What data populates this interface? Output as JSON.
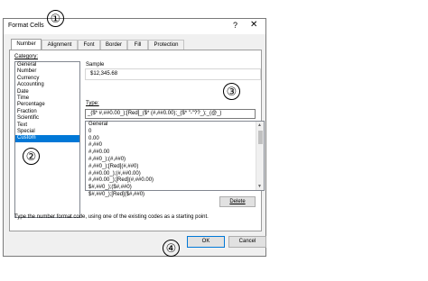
{
  "window": {
    "title": "Format Cells",
    "help_glyph": "?",
    "close_glyph": "✕"
  },
  "tabs": [
    "Number",
    "Alignment",
    "Font",
    "Border",
    "Fill",
    "Protection"
  ],
  "category": {
    "label": "Category:",
    "items": [
      "General",
      "Number",
      "Currency",
      "Accounting",
      "Date",
      "Time",
      "Percentage",
      "Fraction",
      "Scientific",
      "Text",
      "Special",
      "Custom"
    ],
    "selected": "Custom"
  },
  "sample": {
    "label": "Sample",
    "value": "$12,345.68"
  },
  "type": {
    "label": "Type:",
    "value": "_($* #,##0.00_);[Red]_($* (#,##0.00);_($* \"-\"??_);_(@_)",
    "formats": [
      "General",
      "0",
      "0.00",
      "#,##0",
      "#,##0.00",
      "#,##0_);(#,##0)",
      "#,##0_);[Red](#,##0)",
      "#,##0.00_);(#,##0.00)",
      "#,##0.00_);[Red](#,##0.00)",
      "$#,##0_);($#,##0)",
      "$#,##0_);[Red]($#,##0)"
    ]
  },
  "buttons": {
    "delete": "Delete",
    "ok": "OK",
    "cancel": "Cancel"
  },
  "hint": "Type the number format code, using one of the existing codes as a starting point.",
  "markers": [
    "①",
    "②",
    "③",
    "④"
  ]
}
